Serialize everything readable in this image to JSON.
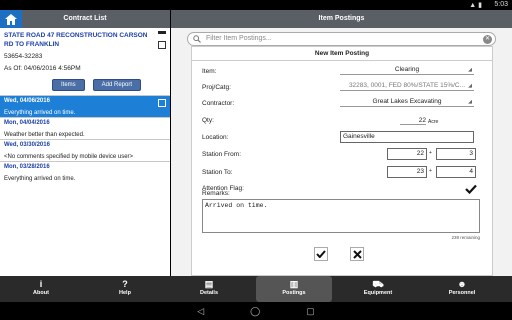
{
  "status": {
    "time": "5:03"
  },
  "left": {
    "title": "Contract List",
    "contract": {
      "title": "STATE ROAD 47 RECONSTRUCTION CARSON RD TO FRANKLIN",
      "number": "53654-32283",
      "as_of": "As Of: 04/06/2016 4:56PM"
    },
    "buttons": {
      "items": "Items",
      "add_report": "Add Report"
    },
    "entries": [
      {
        "date": "Wed, 04/06/2016",
        "text": "Everything arrived on time."
      },
      {
        "date": "Mon, 04/04/2016",
        "text": "Weather better than expected."
      },
      {
        "date": "Wed, 03/30/2016",
        "text": "<No comments specified by mobile device user>"
      },
      {
        "date": "Mon, 03/28/2016",
        "text": "Everything arrived on time."
      }
    ]
  },
  "right": {
    "title": "Item Postings",
    "filter_placeholder": "Filter Item Postings...",
    "form": {
      "title": "New Item Posting",
      "item_label": "Item:",
      "item_value": "Clearing",
      "proj_label": "Proj/Catg:",
      "proj_value": "32283, 0001, FED 80%/STATE 15%/C...",
      "contractor_label": "Contractor:",
      "contractor_value": "Great Lakes Excavating",
      "qty_label": "Qty:",
      "qty_value": "22",
      "qty_unit": "Acre",
      "location_label": "Location:",
      "location_value": "Gainesville",
      "station_from_label": "Station From:",
      "station_from_a": "22",
      "station_from_b": "3",
      "station_to_label": "Station To:",
      "station_to_a": "23",
      "station_to_b": "4",
      "plus": "+",
      "attention_label": "Attention Flag:",
      "remarks_label": "Remarks:",
      "remarks_value": "Arrived on time.",
      "remaining": "239 remaining"
    }
  },
  "tabs": [
    {
      "label": "About",
      "icon": "i"
    },
    {
      "label": "Help",
      "icon": "?"
    },
    {
      "label": "Details",
      "icon": "▤"
    },
    {
      "label": "Postings",
      "icon": "▥"
    },
    {
      "label": "Equipment",
      "icon": "⛟"
    },
    {
      "label": "Personnel",
      "icon": "☻"
    }
  ]
}
